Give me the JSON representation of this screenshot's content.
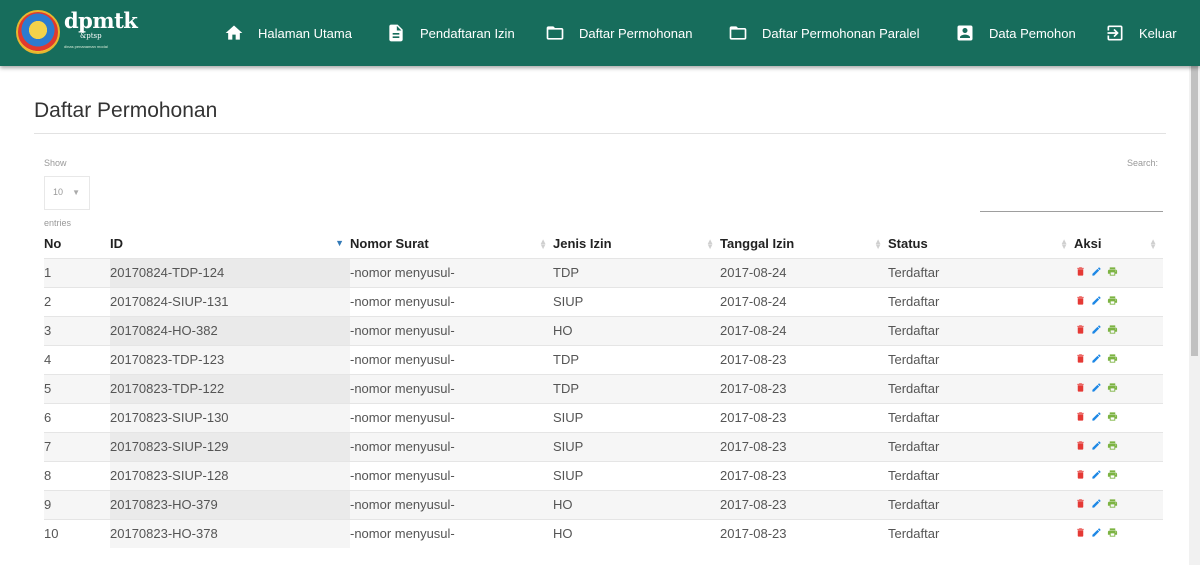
{
  "brand": {
    "name": "dpmtk",
    "sub": "&ptsp",
    "tiny": "dinas penanaman modal"
  },
  "nav": {
    "items": [
      {
        "label": "Halaman Utama",
        "icon": "home-icon"
      },
      {
        "label": "Pendaftaran Izin",
        "icon": "document-icon"
      },
      {
        "label": "Daftar Permohonan",
        "icon": "folder-icon"
      },
      {
        "label": "Daftar Permohonan Paralel",
        "icon": "folder-icon"
      },
      {
        "label": "Data Pemohon",
        "icon": "account-box-icon"
      },
      {
        "label": "Keluar",
        "icon": "logout-icon"
      }
    ]
  },
  "page": {
    "title": "Daftar Permohonan"
  },
  "table_controls": {
    "show_label": "Show",
    "length_value": "10",
    "entries_label": "entries",
    "search_label": "Search:",
    "search_value": ""
  },
  "table": {
    "headers": [
      "No",
      "ID",
      "Nomor Surat",
      "Jenis Izin",
      "Tanggal Izin",
      "Status",
      "Aksi"
    ],
    "rows": [
      {
        "no": "1",
        "id": "20170824-TDP-124",
        "nomor": "-nomor menyusul-",
        "jenis": "TDP",
        "tanggal": "2017-08-24",
        "status": "Terdaftar"
      },
      {
        "no": "2",
        "id": "20170824-SIUP-131",
        "nomor": "-nomor menyusul-",
        "jenis": "SIUP",
        "tanggal": "2017-08-24",
        "status": "Terdaftar"
      },
      {
        "no": "3",
        "id": "20170824-HO-382",
        "nomor": "-nomor menyusul-",
        "jenis": "HO",
        "tanggal": "2017-08-24",
        "status": "Terdaftar"
      },
      {
        "no": "4",
        "id": "20170823-TDP-123",
        "nomor": "-nomor menyusul-",
        "jenis": "TDP",
        "tanggal": "2017-08-23",
        "status": "Terdaftar"
      },
      {
        "no": "5",
        "id": "20170823-TDP-122",
        "nomor": "-nomor menyusul-",
        "jenis": "TDP",
        "tanggal": "2017-08-23",
        "status": "Terdaftar"
      },
      {
        "no": "6",
        "id": "20170823-SIUP-130",
        "nomor": "-nomor menyusul-",
        "jenis": "SIUP",
        "tanggal": "2017-08-23",
        "status": "Terdaftar"
      },
      {
        "no": "7",
        "id": "20170823-SIUP-129",
        "nomor": "-nomor menyusul-",
        "jenis": "SIUP",
        "tanggal": "2017-08-23",
        "status": "Terdaftar"
      },
      {
        "no": "8",
        "id": "20170823-SIUP-128",
        "nomor": "-nomor menyusul-",
        "jenis": "SIUP",
        "tanggal": "2017-08-23",
        "status": "Terdaftar"
      },
      {
        "no": "9",
        "id": "20170823-HO-379",
        "nomor": "-nomor menyusul-",
        "jenis": "HO",
        "tanggal": "2017-08-23",
        "status": "Terdaftar"
      },
      {
        "no": "10",
        "id": "20170823-HO-378",
        "nomor": "-nomor menyusul-",
        "jenis": "HO",
        "tanggal": "2017-08-23",
        "status": "Terdaftar"
      }
    ],
    "action_icons": [
      "delete-icon",
      "edit-icon",
      "print-icon"
    ]
  },
  "colors": {
    "navbar": "#176d5c",
    "delete": "#e53935",
    "edit": "#1e88e5",
    "print": "#7cb342"
  }
}
